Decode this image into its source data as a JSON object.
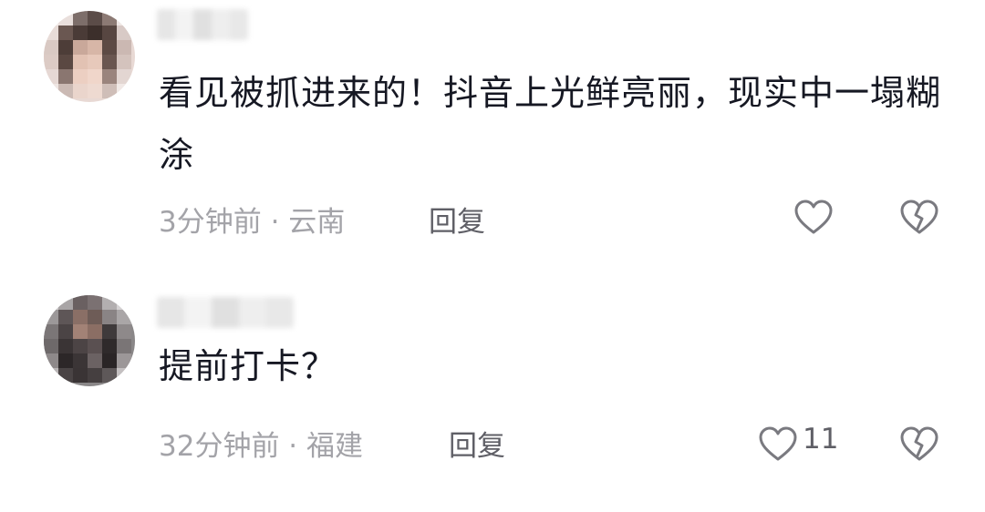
{
  "comments": [
    {
      "username": "",
      "text": "看见被抓进来的！抖音上光鲜亮丽，现实中一塌糊涂",
      "meta": "3分钟前 · 云南",
      "reply_label": "回复",
      "like_count": "",
      "like_icon": "heart-outline-icon",
      "dislike_icon": "broken-heart-icon"
    },
    {
      "username": "",
      "text": "提前打卡？",
      "meta": "32分钟前 · 福建",
      "reply_label": "回复",
      "like_count": "11",
      "like_icon": "heart-outline-icon",
      "dislike_icon": "broken-heart-icon"
    }
  ],
  "colors": {
    "text": "#161823",
    "meta": "#a3a3a8",
    "action": "#5f5f66",
    "icon": "#7a7a80"
  }
}
